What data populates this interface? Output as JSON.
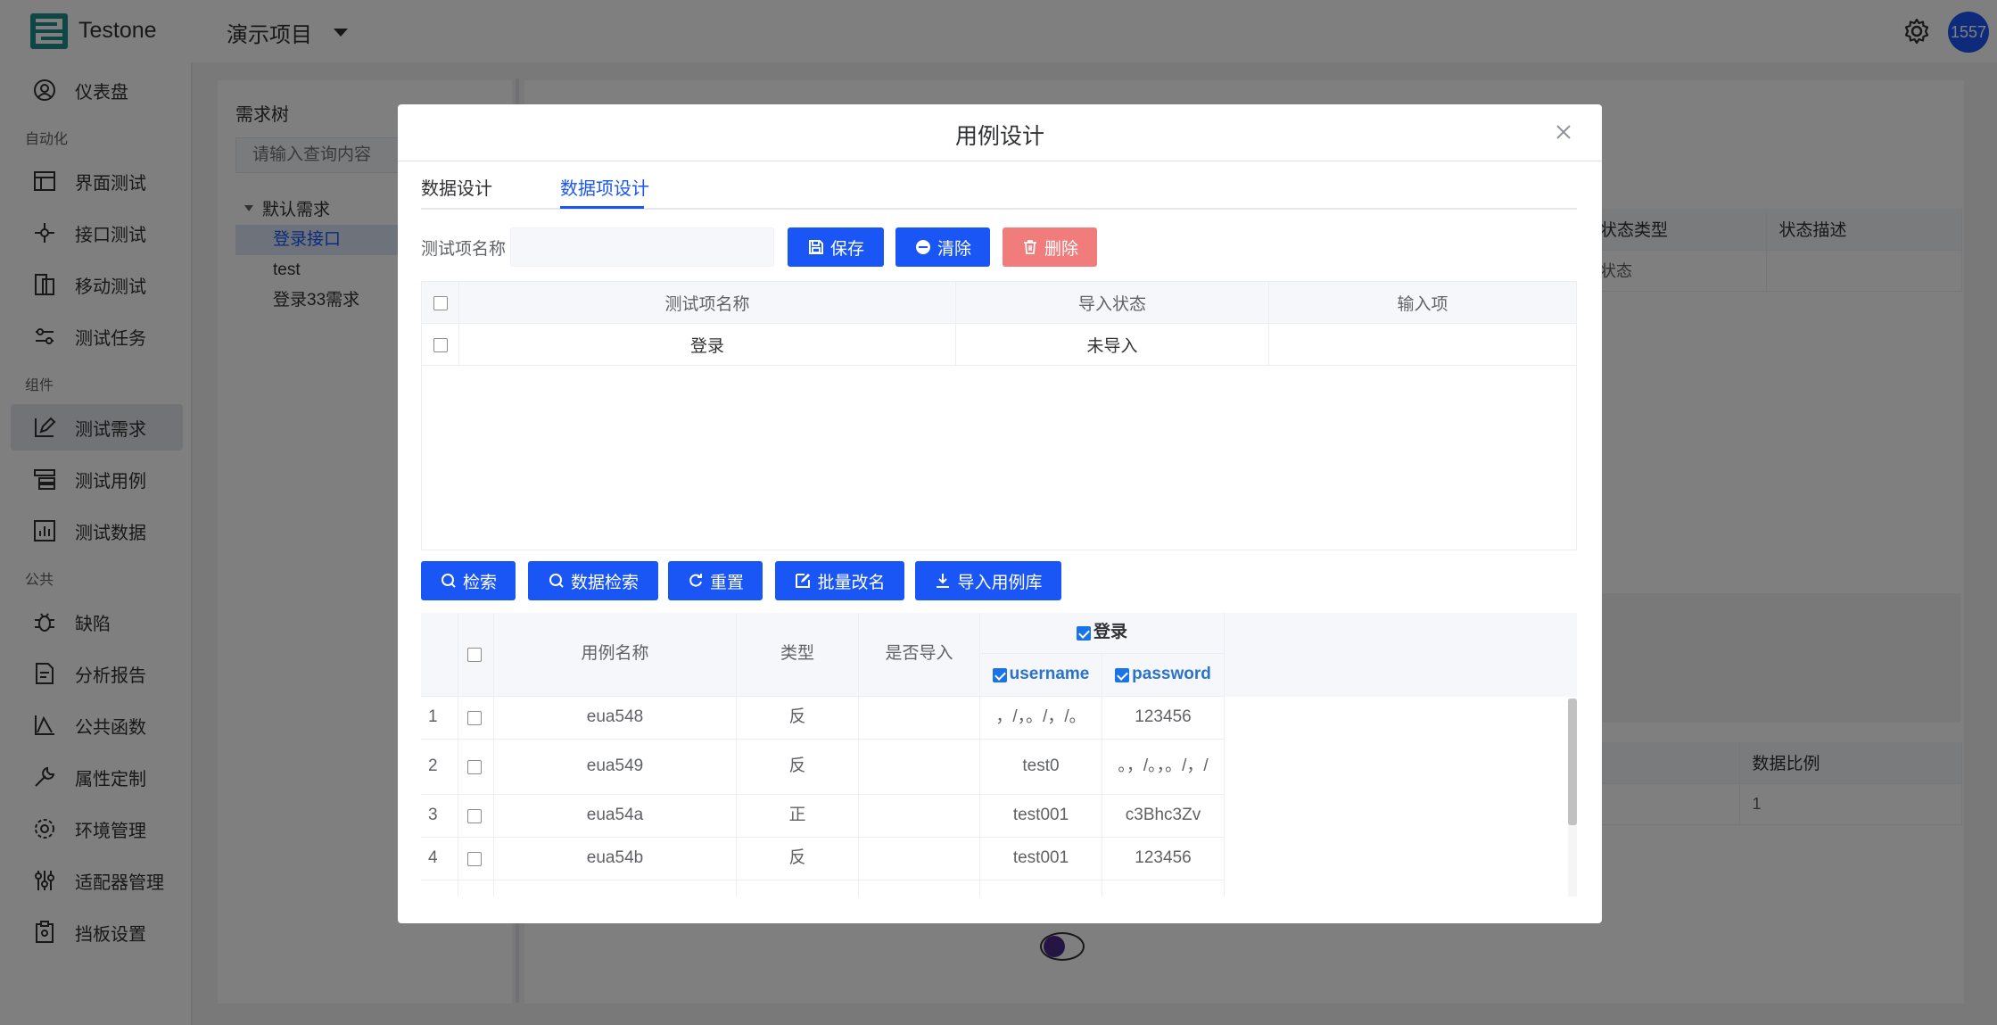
{
  "header": {
    "brand": "Testone",
    "project": "演示项目",
    "user": "1557"
  },
  "sidebar": {
    "dashboard": "仪表盘",
    "group_automation": "自动化",
    "ui_test": "界面测试",
    "api_test": "接口测试",
    "mobile_test": "移动测试",
    "test_task": "测试任务",
    "group_component": "组件",
    "test_requirement": "测试需求",
    "test_case": "测试用例",
    "test_data": "测试数据",
    "group_public": "公共",
    "defect": "缺陷",
    "analysis_report": "分析报告",
    "public_function": "公共函数",
    "attribute_custom": "属性定制",
    "env_manage": "环境管理",
    "adapter_manage": "适配器管理",
    "mock_settings": "挡板设置"
  },
  "requirement_tree": {
    "title": "需求树",
    "search_placeholder": "请输入查询内容",
    "root": "默认需求",
    "items": [
      "登录接口",
      "test",
      "登录33需求"
    ]
  },
  "background": {
    "state_table": {
      "headers": [
        "状态类型",
        "状态描述"
      ],
      "row": [
        "状态",
        ""
      ]
    },
    "ratio_table": {
      "headers": [
        "",
        "数据比例"
      ],
      "row": [
        "",
        "1"
      ]
    }
  },
  "dialog": {
    "title": "用例设计",
    "tabs": [
      "数据设计",
      "数据项设计"
    ],
    "form": {
      "label": "测试项名称",
      "value": ""
    },
    "buttons": {
      "save": "保存",
      "clear": "清除",
      "delete": "删除"
    },
    "item_table": {
      "headers": [
        "测试项名称",
        "导入状态",
        "输入项"
      ],
      "rows": [
        {
          "name": "登录",
          "status": "未导入",
          "input": ""
        }
      ]
    },
    "actions": {
      "search": "检索",
      "data_search": "数据检索",
      "reset": "重置",
      "batch_rename": "批量改名",
      "import_library": "导入用例库"
    },
    "case_table": {
      "headers": {
        "name": "用例名称",
        "type": "类型",
        "imported": "是否导入",
        "group": "登录",
        "col_username": "username",
        "col_password": "password"
      },
      "rows": [
        {
          "no": "1",
          "name": "eua548",
          "type": "反",
          "imported": "",
          "username": "，/，。/，/。",
          "password": "123456"
        },
        {
          "no": "2",
          "name": "eua549",
          "type": "反",
          "imported": "",
          "username": "test0",
          "password": "。，/。，。/，/"
        },
        {
          "no": "3",
          "name": "eua54a",
          "type": "正",
          "imported": "",
          "username": "test001",
          "password": "c3Bhc3Zv"
        },
        {
          "no": "4",
          "name": "eua54b",
          "type": "反",
          "imported": "",
          "username": "test001",
          "password": "123456"
        }
      ]
    }
  }
}
